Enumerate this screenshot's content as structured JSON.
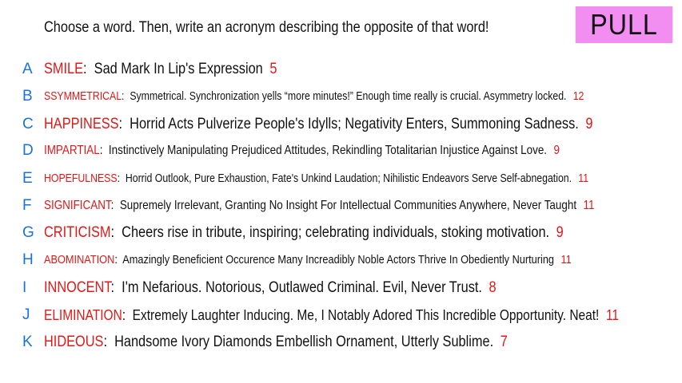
{
  "instruction": "Choose a word. Then, write an acronym describing the opposite of that word!",
  "badge": "PULL",
  "colors": {
    "letter": "#1a73d9",
    "word": "#e01818",
    "badge_bg": "#f28ef2"
  },
  "rows": [
    {
      "letter": "A",
      "word": "SMILE",
      "acronym": "Sad Mark In Lip's Expression",
      "count": "5"
    },
    {
      "letter": "B",
      "word": "SSYMMETRICAL",
      "acronym": "Symmetrical. Synchronization yells “more minutes!” Enough time really is crucial. Asymmetry locked.",
      "count": "12"
    },
    {
      "letter": "C",
      "word": "HAPPINESS",
      "acronym": "Horrid Acts Pulverize People's Idylls; Negativity Enters, Summoning Sadness.",
      "count": "9"
    },
    {
      "letter": "D",
      "word": "IMPARTIAL",
      "acronym": "Instinctively Manipulating Prejudiced Attitudes, Rekindling Totalitarian Injustice Against Love.",
      "count": "9"
    },
    {
      "letter": "E",
      "word": "HOPEFULNESS",
      "acronym": "Horrid Outlook, Pure Exhaustion, Fate's Unkind Laudation; Nihilistic Endeavors Serve Self-abnegation.",
      "count": "11"
    },
    {
      "letter": "F",
      "word": "SIGNIFICANT",
      "acronym": "Supremely Irrelevant, Granting No Insight For Intellectual Communities Anywhere, Never Taught",
      "count": "11"
    },
    {
      "letter": "G",
      "word": "CRITICISM",
      "acronym": "Cheers rise in tribute, inspiring; celebrating individuals, stoking motivation.",
      "count": "9"
    },
    {
      "letter": "H",
      "word": "ABOMINATION",
      "acronym": "Amazingly Beneficient Occurence Many Increadibly Noble Actors Thrive In Obediently Nurturing",
      "count": "11"
    },
    {
      "letter": "I",
      "word": "INNOCENT",
      "acronym": "I'm Nefarious. Notorious, Outlawed Criminal. Evil, Never Trust.",
      "count": "8"
    },
    {
      "letter": "J",
      "word": "ELIMINATION",
      "acronym": "Extremely Laughter Inducing. Me, I Notably Adored This Incredible Opportunity. Neat!",
      "count": "11"
    },
    {
      "letter": "K",
      "word": "HIDEOUS",
      "acronym": "Handsome Ivory Diamonds Embellish Ornament, Utterly Sublime.",
      "count": "7"
    }
  ]
}
